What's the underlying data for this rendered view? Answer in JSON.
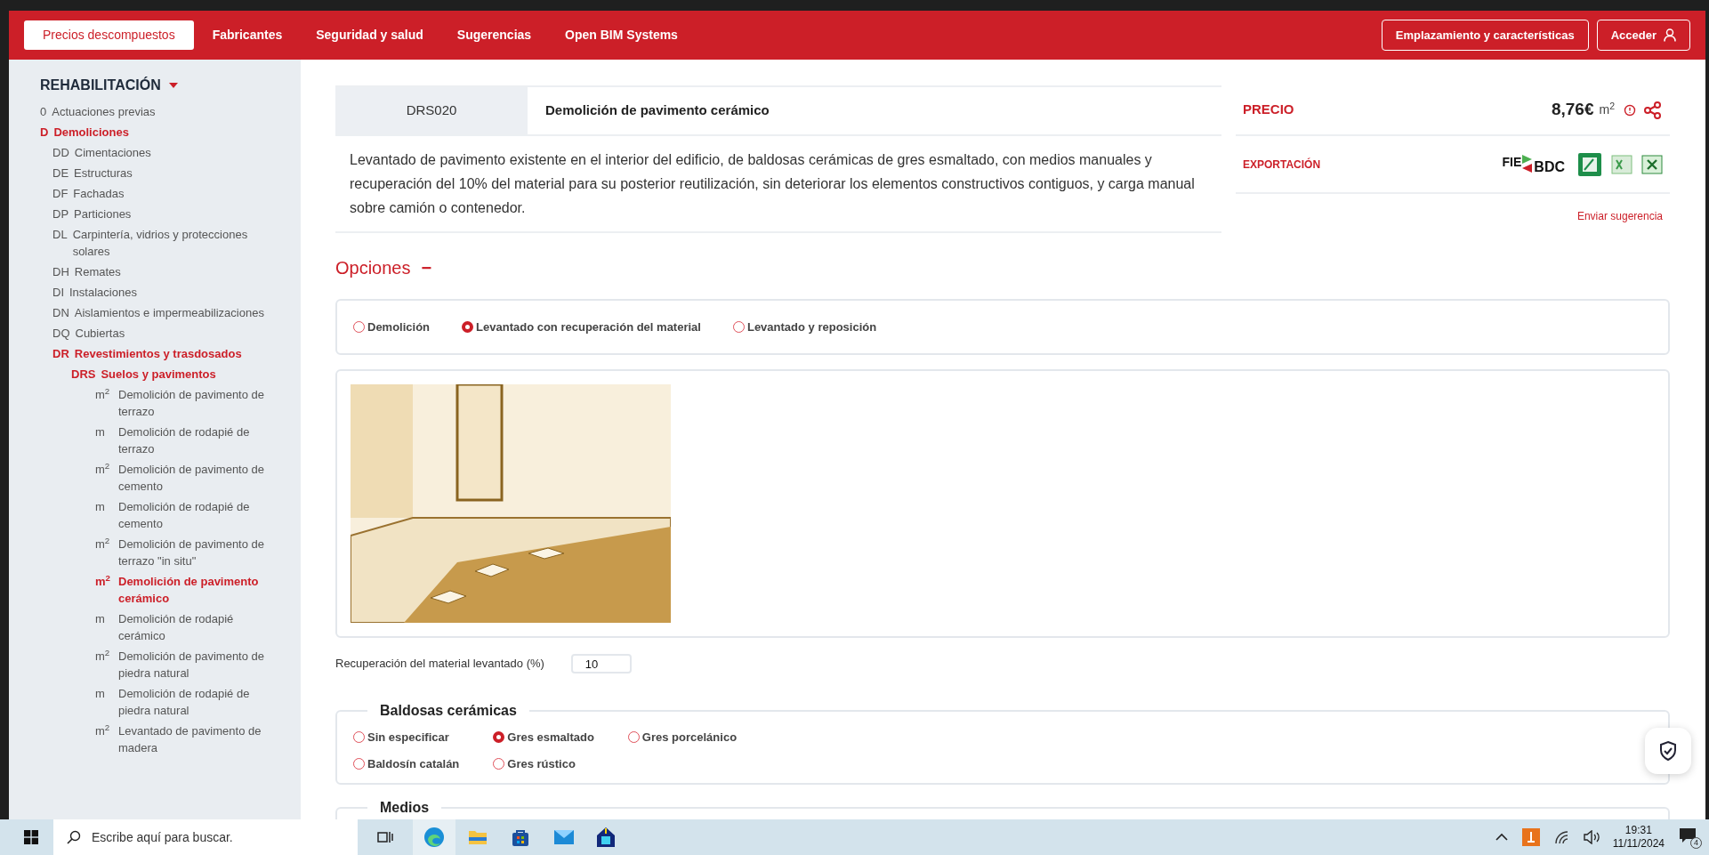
{
  "nav": {
    "tabs": [
      {
        "label": "Precios descompuestos",
        "selected": true
      },
      {
        "label": "Fabricantes",
        "selected": false
      },
      {
        "label": "Seguridad y salud",
        "selected": false
      },
      {
        "label": "Sugerencias",
        "selected": false
      },
      {
        "label": "Open BIM Systems",
        "selected": false
      }
    ],
    "buttons": [
      {
        "label": "Emplazamiento y características",
        "kind": "plain"
      },
      {
        "label": "Acceder",
        "kind": "user"
      }
    ]
  },
  "sidebar": {
    "title": "REHABILITACIÓN",
    "items": [
      {
        "code": "0",
        "label": "Actuaciones previas",
        "expanded": false
      },
      {
        "code": "D",
        "label": "Demoliciones",
        "expanded": true,
        "children": [
          {
            "code": "DD",
            "label": "Cimentaciones",
            "expanded": false
          },
          {
            "code": "DE",
            "label": "Estructuras",
            "expanded": false
          },
          {
            "code": "DF",
            "label": "Fachadas",
            "expanded": false
          },
          {
            "code": "DP",
            "label": "Particiones",
            "expanded": false
          },
          {
            "code": "DL",
            "label": "Carpintería, vidrios y protecciones solares",
            "expanded": false
          },
          {
            "code": "DH",
            "label": "Remates",
            "expanded": false
          },
          {
            "code": "DI",
            "label": "Instalaciones",
            "expanded": false
          },
          {
            "code": "DN",
            "label": "Aislamientos e impermeabilizaciones",
            "expanded": false
          },
          {
            "code": "DQ",
            "label": "Cubiertas",
            "expanded": false
          },
          {
            "code": "DR",
            "label": "Revestimientos y trasdosados",
            "expanded": true,
            "children": [
              {
                "code": "DRS",
                "label": "Suelos y pavimentos",
                "expanded": true,
                "children": [
                  {
                    "unit": "m$^{2}$",
                    "label": "Demolición de pavimento de terrazo",
                    "selected": false
                  },
                  {
                    "unit": "m",
                    "label": "Demolición de rodapié de terrazo",
                    "selected": false
                  },
                  {
                    "unit": "m$^{2}$",
                    "label": "Demolición de pavimento de cemento",
                    "selected": false
                  },
                  {
                    "unit": "m",
                    "label": "Demolición de rodapié de cemento",
                    "selected": false
                  },
                  {
                    "unit": "m$^{2}$",
                    "label": "Demolición de pavimento de terrazo \"in situ\"",
                    "selected": false
                  },
                  {
                    "unit": "m$^{2}$",
                    "label": "Demolición de pavimento cerámico",
                    "selected": true
                  },
                  {
                    "unit": "m",
                    "label": "Demolición de rodapié cerámico",
                    "selected": false
                  },
                  {
                    "unit": "m$^{2}$",
                    "label": "Demolición de pavimento de piedra natural",
                    "selected": false
                  },
                  {
                    "unit": "m",
                    "label": "Demolición de rodapié de piedra natural",
                    "selected": false
                  },
                  {
                    "unit": "m$^{2}$",
                    "label": "Levantado de pavimento de madera",
                    "selected": false
                  }
                ]
              }
            ]
          }
        ]
      }
    ]
  },
  "item": {
    "code": "DRS020",
    "title": "Demolición de pavimento cerámico",
    "description": "Levantado de pavimento existente en el interior del edificio, de baldosas cerámicas de gres esmaltado, con medios manuales y recuperación del 10% del material para su posterior reutilización, sin deteriorar los elementos constructivos contiguos, y carga manual sobre camión o contenedor."
  },
  "price": {
    "label": "PRECIO",
    "value": "8,76€",
    "unit": "m$^{2}$",
    "export_label": "EXPORTACIÓN",
    "export_logo": [
      "FIE",
      "BDC"
    ],
    "suggest_link": "Enviar sugerencia"
  },
  "options": {
    "title": "Opciones",
    "toggle": "−",
    "groups": [
      {
        "kind": "radios",
        "choices": [
          {
            "label": "Demolición",
            "selected": false
          },
          {
            "label": "Levantado con recuperación del material",
            "selected": true
          },
          {
            "label": "Levantado y reposición",
            "selected": false
          }
        ]
      },
      {
        "kind": "image"
      },
      {
        "kind": "field",
        "label": "Recuperación del material levantado (%)",
        "value": "10"
      },
      {
        "kind": "radios",
        "legend": "Baldosas cerámicas",
        "choices": [
          {
            "label": "Sin especificar",
            "selected": false
          },
          {
            "label": "Gres esmaltado",
            "selected": true
          },
          {
            "label": "Gres porcelánico",
            "selected": false
          },
          {
            "label": "Baldosín catalán",
            "selected": false
          },
          {
            "label": "Gres rústico",
            "selected": false
          }
        ]
      },
      {
        "kind": "radios",
        "legend": "Medios"
      }
    ]
  },
  "taskbar": {
    "search_placeholder": "Escribe aquí para buscar.",
    "time": "19:31",
    "date": "11/11/2024",
    "notifications": "4"
  }
}
